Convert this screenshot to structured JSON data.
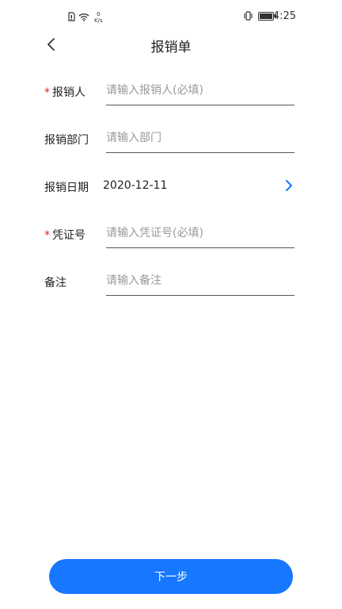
{
  "status_bar": {
    "net_speed_value": "0",
    "net_speed_unit": "K/s",
    "time": "4:25"
  },
  "header": {
    "title": "报销单"
  },
  "form": {
    "reimburser": {
      "label": "报销人",
      "required_mark": "*",
      "value": "",
      "placeholder": "请输入报销人(必填)"
    },
    "department": {
      "label": "报销部门",
      "value": "",
      "placeholder": "请输入部门"
    },
    "date": {
      "label": "报销日期",
      "value": "2020-12-11"
    },
    "voucher_no": {
      "label": "凭证号",
      "required_mark": "*",
      "value": "",
      "placeholder": "请输入凭证号(必填)"
    },
    "remarks": {
      "label": "备注",
      "value": "",
      "placeholder": "请输入备注"
    }
  },
  "footer": {
    "next_label": "下一步"
  },
  "colors": {
    "accent": "#1677ff",
    "required": "#e02020",
    "placeholder": "#999999"
  },
  "icons": [
    "sim-icon",
    "wifi-icon",
    "vibrate-icon",
    "battery-icon",
    "back-arrow-icon",
    "chevron-right-icon"
  ]
}
